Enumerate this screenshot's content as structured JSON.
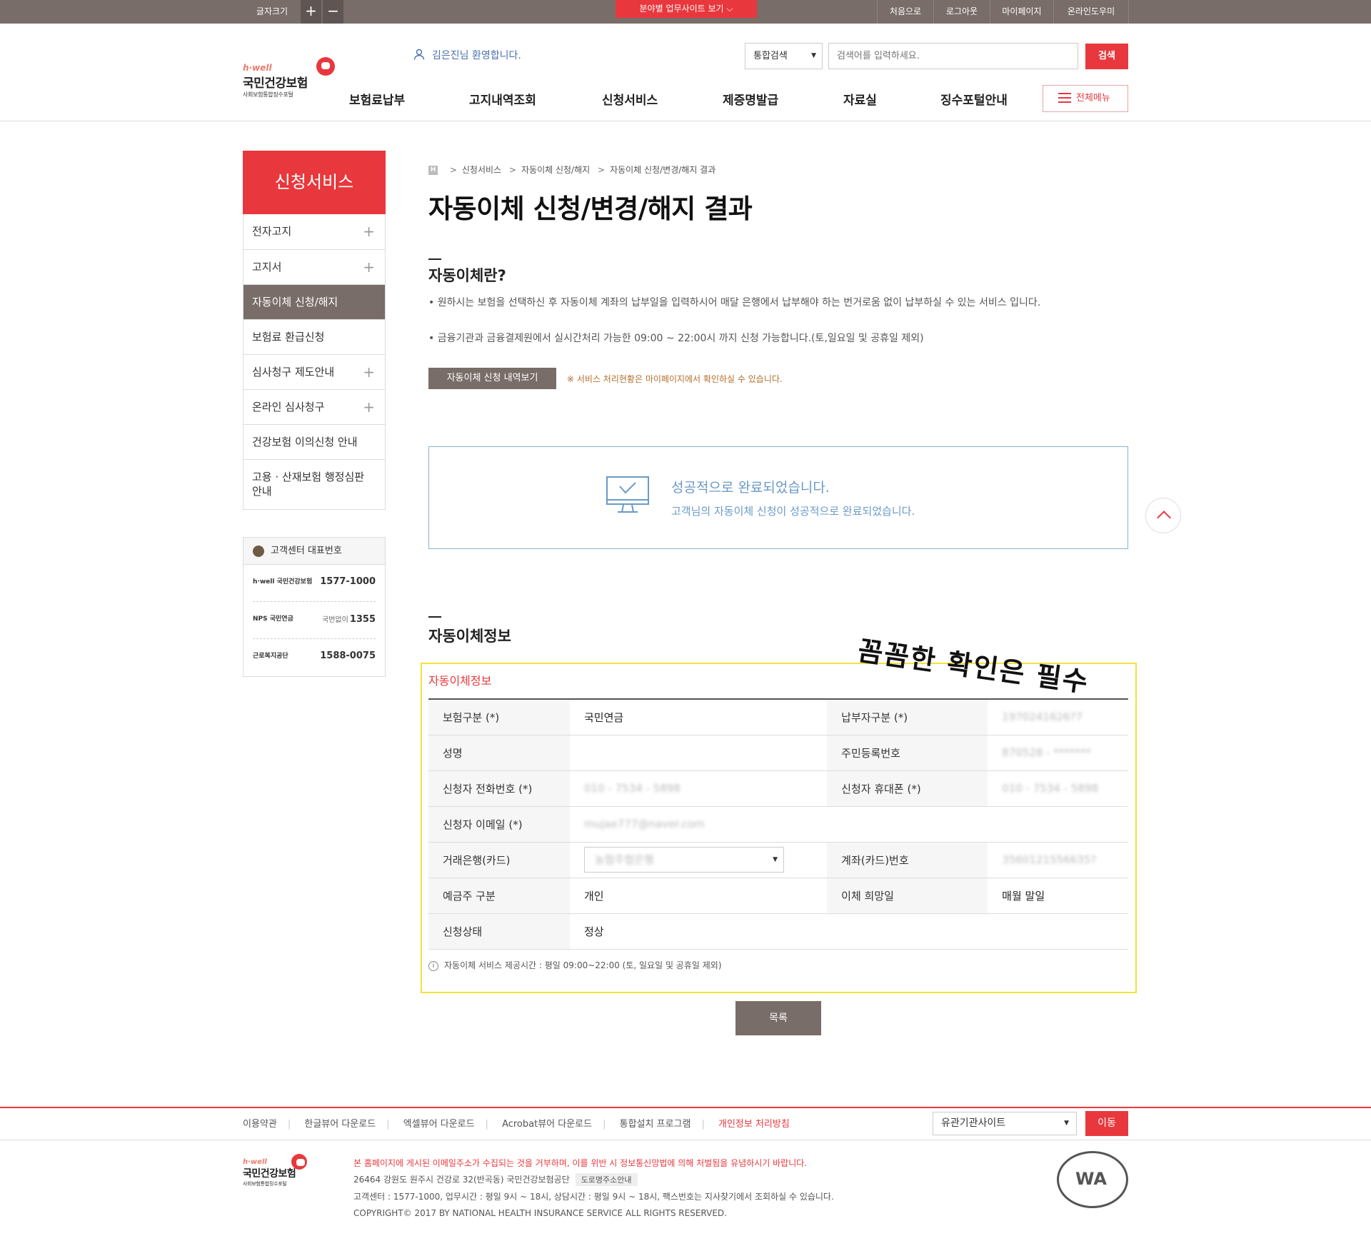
{
  "topbar": {
    "font_size_label": "글자크기",
    "plus": "+",
    "minus": "−",
    "field_sites": "분야별 업무사이트 보기",
    "links": [
      "처음으로",
      "로그아웃",
      "마이페이지",
      "온라인도우미"
    ]
  },
  "logo": {
    "brand_script": "h·well",
    "name": "국민건강보험",
    "sub": "사회보험통합징수포털"
  },
  "header": {
    "welcome": "김은진님 환영합니다.",
    "search_scope": "통합검색",
    "search_placeholder": "검색어를 입력하세요.",
    "search_button": "검색",
    "all_menu": "전체메뉴"
  },
  "gnb": [
    "보험료납부",
    "고지내역조회",
    "신청서비스",
    "제증명발급",
    "자료실",
    "징수포털안내"
  ],
  "lnb": {
    "title": "신청서비스",
    "items": [
      {
        "label": "전자고지",
        "plus": "+"
      },
      {
        "label": "고지서",
        "plus": "+"
      },
      {
        "label": "자동이체 신청/해지",
        "plus": ""
      },
      {
        "label": "보험료 환급신청",
        "plus": ""
      },
      {
        "label": "심사청구 제도안내",
        "plus": "+"
      },
      {
        "label": "온라인 심사청구",
        "plus": "+"
      },
      {
        "label": "건강보험 이의신청 안내",
        "plus": ""
      },
      {
        "label": "고용 · 산재보험 행정심판 안내",
        "plus": ""
      }
    ]
  },
  "customer_center": {
    "title": "고객센터 대표번호",
    "rows": [
      {
        "org": "h·well 국민건강보험",
        "prefix": "",
        "number": "1577-1000"
      },
      {
        "org": "NPS 국민연금",
        "prefix": "국번없이",
        "number": "1355"
      },
      {
        "org": "근로복지공단",
        "prefix": "",
        "number": "1588-0075"
      }
    ]
  },
  "breadcrumb": {
    "home": "H",
    "items": [
      "신청서비스",
      "자동이체 신청/해지",
      "자동이체 신청/변경/해지 결과"
    ]
  },
  "page_title": "자동이체 신청/변경/해지 결과",
  "intro": {
    "title": "자동이체란?",
    "bullet1": "• 원하시는 보험을 선택하신 후 자동이체 계좌의 납부일을 입력하시어 매달 은행에서 납부해야 하는 번거로움 없이 납부하실 수 있는 서비스 입니다.",
    "bullet2": "• 금융기관과 금융결제원에서 실시간처리 가능한 09:00 ~ 22:00시 까지 신청 가능합니다.(토,일요일 및 공휴일 제외)",
    "history_button": "자동이체 신청 내역보기",
    "history_note": "※ 서비스 처리현황은 마이페이지에서 확인하실 수 있습니다."
  },
  "result": {
    "title": "성공적으로 완료되었습니다.",
    "message": "고객님의 자동이체 신청이 성공적으로 완료되었습니다."
  },
  "stamp": "꼼꼼한 확인은 필수",
  "info": {
    "section_title": "자동이체정보",
    "caption": "자동이체정보",
    "rows": [
      {
        "l1": "보험구분 (*)",
        "v1": "국민연금",
        "l2": "납부자구분 (*)",
        "v2": "1970241626?7"
      },
      {
        "l1": "성명",
        "v1": "",
        "l2": "주민등록번호",
        "v2": "870528 - *******"
      },
      {
        "l1": "신청자 전화번호 (*)",
        "v1": "010 - 7534 - 5898",
        "l2": "신청자 휴대폰 (*)",
        "v2": "010 - 7534 - 5898"
      },
      {
        "l1": "신청자 이메일 (*)",
        "v1": "mujae777@naver.com"
      },
      {
        "l1": "거래은행(카드)",
        "v1": "농협주협은행",
        "l2": "계좌(카드)번호",
        "v2": "3560121556635?"
      },
      {
        "l1": "예금주 구분",
        "v1": "개인",
        "l2": "이체 희망일",
        "v2": "매월 말일"
      },
      {
        "l1": "신청상태",
        "v1": "정상"
      }
    ],
    "note": "자동이체 서비스 제공시간 : 평일 09:00~22:00 (토, 일요일 및 공휴일 제외)",
    "list_button": "목록"
  },
  "footer": {
    "links": [
      "이용약관",
      "한글뷰어 다운로드",
      "엑셀뷰어 다운로드",
      "Acrobat뷰어 다운로드",
      "통합설치 프로그램",
      "개인정보 처리방침"
    ],
    "related_sites": "유관기관사이트",
    "go": "이동",
    "warning": "본 홈페이지에 게시된 이메일주소가 수집되는 것을 거부하며, 이를 위반 시 정보통신망법에 의해 처벌됨을 유념하시기 바랍니다.",
    "address": "26464 강원도 원주시 건강로 32(반곡동) 국민건강보험공단",
    "address_tag": "도로명주소안내",
    "hours": "고객센터 : 1577-1000, 업무시간 : 평일 9시 ~ 18시, 상담시간 : 평일 9시 ~ 18시, 팩스번호는 지사찾기에서 조회하실 수 있습니다.",
    "copyright": "COPYRIGHT© 2017 BY NATIONAL HEALTH INSURANCE SERVICE ALL RIGHTS RESERVED.",
    "wa_mark": "WA"
  },
  "colors": {
    "brand_red": "#e8383d",
    "brown": "#796d69",
    "result_blue": "#6a9ac6",
    "highlight_yellow": "#f5e23b"
  }
}
